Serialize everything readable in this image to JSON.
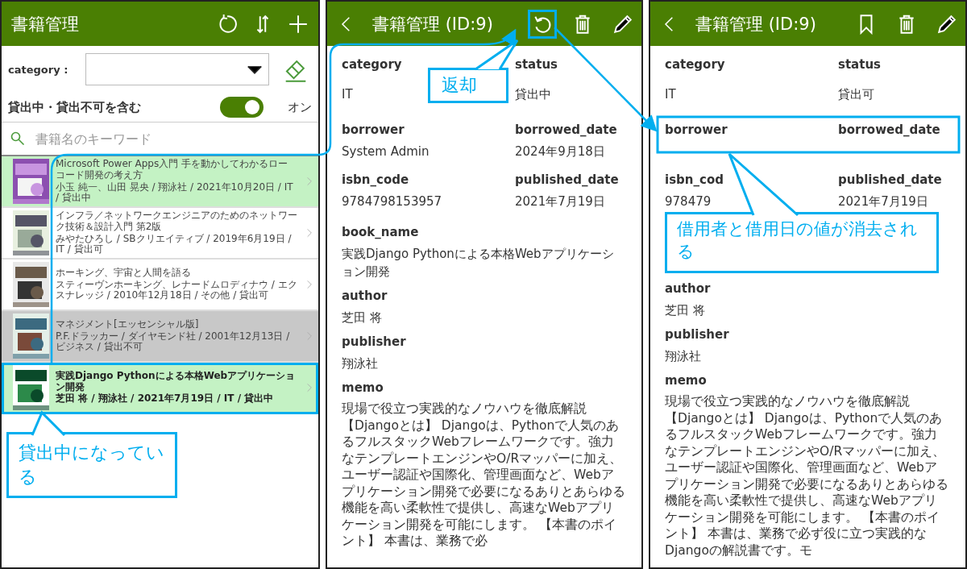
{
  "list_screen": {
    "title": "書籍管理",
    "filter": {
      "label": "category :"
    },
    "toggle": {
      "label": "貸出中・貸出不可を含む",
      "on": true,
      "state_text": "オン"
    },
    "search": {
      "placeholder": "書籍名のキーワード"
    },
    "books": [
      {
        "title": "Microsoft Power Apps入門 手を動かしてわかるローコード開発の考え方",
        "meta": "小玉 純一、山田 晃央 / 翔泳社 / 2021年10月20日 / IT / 貸出中",
        "kind": "lent",
        "selected": false
      },
      {
        "title": "インフラ／ネットワークエンジニアのためのネットワーク技術＆設計入門 第2版",
        "meta": "みやたひろし / SBクリエイティブ / 2019年6月19日 / IT / 貸出可",
        "kind": "available",
        "selected": false
      },
      {
        "title": "ホーキング、宇宙と人間を語る",
        "meta": "スティーヴンホーキング、レナードムロディナウ / エクスナレッジ / 2010年12月18日 / その他 / 貸出可",
        "kind": "available",
        "selected": false
      },
      {
        "title": "マネジメント[エッセンシャル版]",
        "meta": "P.F.ドラッカー / ダイヤモンド社 / 2001年12月13日 / ビジネス / 貸出不可",
        "kind": "unavailable",
        "selected": false
      },
      {
        "title": "実践Django Pythonによる本格Webアプリケーション開発",
        "meta": "芝田 将 / 翔泳社 / 2021年7月19日 / IT / 貸出中",
        "kind": "lent",
        "selected": true
      }
    ],
    "note": "貸出中になっている"
  },
  "detail_before": {
    "title": "書籍管理 (ID:9)",
    "note": "返却",
    "fields": [
      {
        "label": "category",
        "value": "IT",
        "kind": "half"
      },
      {
        "label": "status",
        "value": "貸出中",
        "kind": "half"
      },
      {
        "label": "borrower",
        "value": "System Admin",
        "kind": "half"
      },
      {
        "label": "borrowed_date",
        "value": "2024年9月18日",
        "kind": "half"
      },
      {
        "label": "isbn_code",
        "value": "9784798153957",
        "kind": "half"
      },
      {
        "label": "published_date",
        "value": "2021年7月19日",
        "kind": "half"
      },
      {
        "label": "book_name",
        "value": "実践Django Pythonによる本格Webアプリケーション開発",
        "kind": "full"
      },
      {
        "label": "author",
        "value": "芝田 将",
        "kind": "full"
      },
      {
        "label": "publisher",
        "value": "翔泳社",
        "kind": "full"
      },
      {
        "label": "memo",
        "value": "現場で役立つ実践的なノウハウを徹底解説【Djangoとは】 Djangoは、Pythonで人気のあるフルスタックWebフレームワークです。強力なテンプレートエンジンやO/Rマッパーに加え、ユーザー認証や国際化、管理画面など、Webアプリケーション開発で必要になるありとあらゆる機能を高い柔軟性で提供し、高速なWebアプリケーション開発を可能にします。 【本書のポイント】 本書は、業務で必",
        "kind": "full"
      }
    ]
  },
  "detail_after": {
    "title": "書籍管理 (ID:9)",
    "note": "借用者と借用日の値が消去される",
    "fields": [
      {
        "label": "category",
        "value": "IT",
        "kind": "half"
      },
      {
        "label": "status",
        "value": "貸出可",
        "kind": "half"
      },
      {
        "label": "borrower",
        "kind": "half"
      },
      {
        "label": "borrowed_date",
        "kind": "half"
      },
      {
        "label": "isbn_cod",
        "value": "978479",
        "kind": "half"
      },
      {
        "label": "published_date",
        "value": "2021年7月19日",
        "kind": "half"
      },
      {
        "label": "author",
        "value": "芝田 将",
        "kind": "full"
      },
      {
        "label": "publisher",
        "value": "翔泳社",
        "kind": "full"
      },
      {
        "label": "memo",
        "value": "現場で役立つ実践的なノウハウを徹底解説【Djangoとは】 Djangoは、Pythonで人気のあるフルスタックWebフレームワークです。強力なテンプレートエンジンやO/Rマッパーに加え、ユーザー認証や国際化、管理画面など、Webアプリケーション開発で必要になるありとあらゆる機能を高い柔軟性で提供し、高速なWebアプリケーション開発を可能にします。 【本書のポイント】 本書は、業務で必ず役に立つ実践的なDjangoの解説書です。モ",
        "kind": "full"
      }
    ]
  }
}
